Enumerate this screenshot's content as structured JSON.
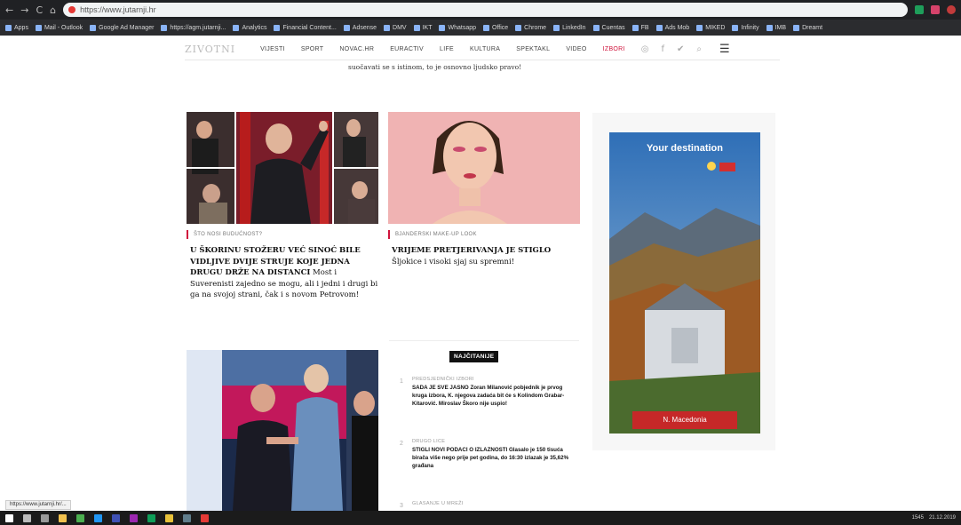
{
  "browser": {
    "nav_glyphs": [
      "←",
      "→",
      "C",
      "⌂"
    ],
    "url": "https://www.jutarnji.hr",
    "bookmarks": [
      "Apps",
      "Mail - Outlook",
      "Google Ad Manager",
      "https://agm.jutarnji...",
      "Analytics",
      "Financial Content...",
      "Adsense",
      "DMV",
      "IKT",
      "Whatsapp",
      "Office",
      "Chrome",
      "LinkedIn",
      "Cuentas",
      "FB",
      "Ads Mob",
      "MIKED",
      "Infinity",
      "IMB",
      "Dreamt"
    ]
  },
  "site": {
    "logo": "ZIVOTNI",
    "nav": [
      "VIJESTI",
      "SPORT",
      "NOVAC.HR",
      "EURACTIV",
      "LIFE",
      "KULTURA",
      "SPEKTAKL",
      "VIDEO",
      "IZBORI"
    ],
    "icons": [
      "instagram-icon",
      "facebook-icon",
      "twitter-icon",
      "search-icon"
    ]
  },
  "prev_article_tail": "suočavati se s istinom, to je osnovno ljudsko pravo!",
  "articles": [
    {
      "tag": "ŠTO NOSI BUDUĆNOST?",
      "headline_bold": "U ŠKORINU STOŽERU VEĆ SINOĆ BILE VIDLJIVE DVIJE STRUJE KOJE JEDNA DRUGU DRŽE NA DISTANCI",
      "headline_rest": "Most i Suverenisti zajedno se mogu, ali i jedni i drugi bi ga na svojoj strani, čak i s novom Petrovom!"
    },
    {
      "tag": "BJANDERSKI MAKE-UP LOOK",
      "headline_bold": "VRIJEME PRETJERIVANJA JE STIGLO",
      "headline_rest": "Šljokice i visoki sjaj su spremni!"
    }
  ],
  "ad": {
    "title": "Your destination",
    "cta": "N. Macedonia"
  },
  "najcitanije": {
    "label": "NAJČITANIJE",
    "items": [
      {
        "num": "1",
        "category": "PREDSJEDNIČKI IZBORI",
        "text": "SADA JE SVE JASNO Zoran Milanović pobjednik je prvog kruga izbora, K. njegova zadaća bit će s Kolindom Grabar-Kitarović. Miroslav Škoro nije uspio!"
      },
      {
        "num": "2",
        "category": "DRUGO LICE",
        "text": "STIGLI NOVI PODACI O IZLAZNOSTI Glasalo je 150 tisuća birača više nego prije pet godina, do 16:30 izlazak je 35,62% građana"
      },
      {
        "num": "3",
        "category": "GLASANJE U MREŽI",
        "text": ""
      }
    ]
  },
  "status_url": "https://www.jutarnji.hr/...",
  "taskbar": {
    "time": "1545",
    "date": "21.12.2019"
  }
}
